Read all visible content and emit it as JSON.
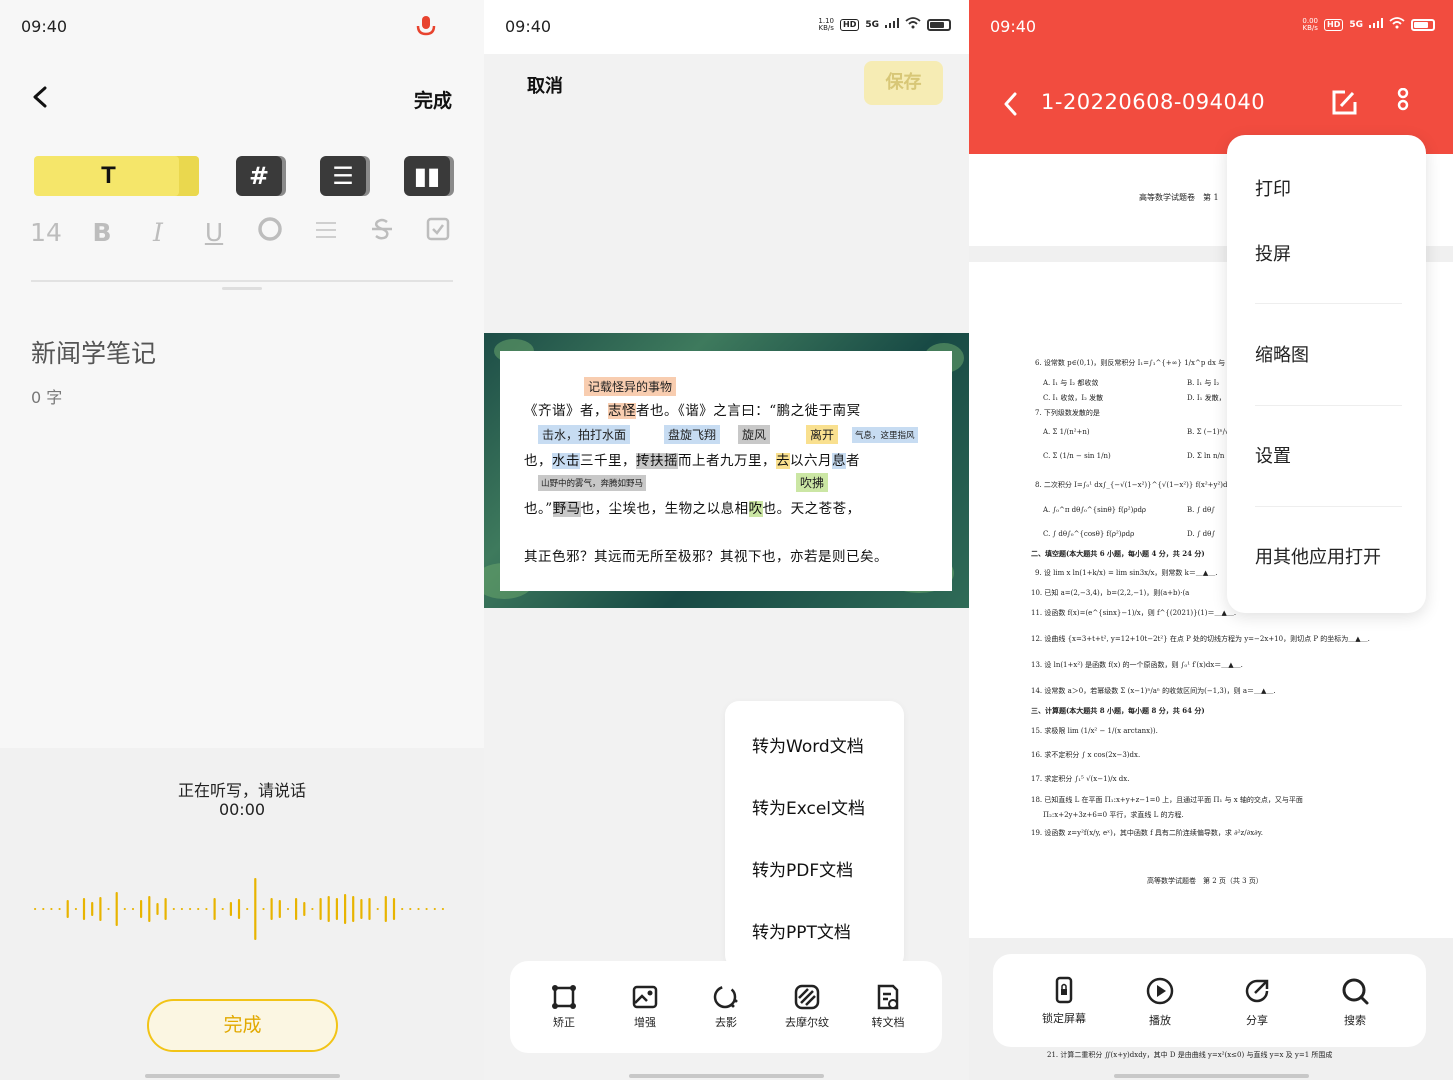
{
  "editor": {
    "time": "09:40",
    "done_top": "完成",
    "format_tools": [
      "T",
      "14",
      "B",
      "I",
      "U"
    ],
    "note_title": "新闻学笔记",
    "char_count": "0 字",
    "listening": "正在听写，请说话",
    "timer": "00:00",
    "done_button": "完成"
  },
  "scanner": {
    "time": "09:40",
    "net_speed": "1.10\nKB/s",
    "net_type": "5G",
    "cancel": "取消",
    "save": "保存",
    "doc_tags": {
      "t1": "记载怪异的事物",
      "t2": "击水，拍打水面",
      "t3": "盘旋飞翔",
      "t4": "旋风",
      "t5": "离开",
      "t6": "气息，这里指风",
      "t7": "山野中的雾气，奔腾如野马",
      "t8": "吹拂"
    },
    "doc_lines": {
      "l1a": "《齐谐》者，",
      "l1b": "志怪",
      "l1c": "者也。《谐》之言曰：“鹏之徙于南冥",
      "l2a": "也，",
      "l2b": "水击",
      "l2c": "三千里，",
      "l2d": "抟扶摇",
      "l2e": "而上者九万里，",
      "l2f": "去",
      "l2g": "以六月",
      "l2h": "息",
      "l2i": "者",
      "l3a": "也。”",
      "l3b": "野马",
      "l3c": "也，尘埃也，生物之以息相",
      "l3d": "吹",
      "l3e": "也。天之苍苍，",
      "l4": "其正色邪？其远而无所至极邪？其视下也，亦若是则已矣。"
    },
    "convert_menu": [
      "转为Word文档",
      "转为Excel文档",
      "转为PDF文档",
      "转为PPT文档"
    ],
    "tools": [
      "矫正",
      "增强",
      "去影",
      "去摩尔纹",
      "转文档"
    ]
  },
  "pdf_viewer": {
    "time": "09:40",
    "net_speed": "0.00\nKB/s",
    "net_type": "5G",
    "file_title": "1-20220608-094040",
    "page_header": "高等数学试题卷　第 1",
    "more_menu": [
      "打印",
      "投屏",
      "缩略图",
      "设置",
      "用其他应用打开"
    ],
    "exam_lines": {
      "q6": "6. 设常数 p∈(0,1)，则反常积分 I₁=∫₁^{+∞} 1/x^p dx 与 I₂=",
      "q6a": "A. I₁ 与 I₂ 都收敛",
      "q6b": "B. I₁ 与 I₂",
      "q6c": "C. I₁ 收敛，I₂ 发散",
      "q6d": "D. I₁ 发散，",
      "q7": "7. 下列级数发散的是",
      "q7a": "A. Σ 1/(n²+n)",
      "q7b": "B. Σ (−1)ⁿ/√n",
      "q7c": "C. Σ (1/n − sin 1/n)",
      "q7d": "D. Σ ln n/n",
      "q8": "8. 二次积分 I=∫₀¹ dx∫_{−√(1−x²)}^{√(1−x²)} f(x²+y²)dy 在极坐标系",
      "q8a": "A. ∫₀^π dθ∫₀^{sinθ} f(ρ²)ρdρ",
      "q8b": "B. ∫ dθ∫",
      "q8c": "C. ∫ dθ∫₀^{cosθ} f(ρ²)ρdρ",
      "q8d": "D. ∫ dθ∫",
      "sec2": "二、填空题(本大题共 6 小题，每小题 4 分，共 24 分)",
      "q9": "9. 设 lim x ln(1+k/x) = lim sin3x/x，则常数 k＝＿▲＿.",
      "q10": "10. 已知 a=(2,−3,4)，b=(2,2,−1)，则(a+b)·(a",
      "q11": "11. 设函数 f(x)=(e^{sinx}−1)/x，则 f^{(2021)}(1)＝＿▲＿.",
      "q12": "12. 设曲线 {x=3+t+t², y=12+10t−2t²} 在点 P 处的切线方程为 y=−2x+10，则切点 P 的坐标为＿▲＿.",
      "q13": "13. 设 ln(1+x²) 是函数 f(x) 的一个原函数，则 ∫₀¹ f′(x)dx＝＿▲＿.",
      "q14": "14. 设常数 a＞0，若幂级数 Σ (x−1)ⁿ/aⁿ 的收敛区间为(−1,3)，则 a＝＿▲＿.",
      "sec3": "三、计算题(本大题共 8 小题，每小题 8 分，共 64 分)",
      "q15": "15. 求极限 lim (1/x² − 1/(x arctanx)).",
      "q16": "16. 求不定积分 ∫ x cos(2x−3)dx.",
      "q17": "17. 求定积分 ∫₁⁵ √(x−1)/x dx.",
      "q18": "18. 已知直线 L 在平面 Π₁:x+y+z−1=0 上，且通过平面 Π₁ 与 x 轴的交点，又与平面",
      "q18b": "Π₂:x+2y+3z+6=0 平行，求直线 L 的方程.",
      "q19": "19. 设函数 z=y²f(x/y, eˣ)，其中函数 f 具有二阶连续偏导数，求 ∂²z/∂x∂y.",
      "footer": "高等数学试题卷　第 2 页（共 3 页）",
      "q21": "21. 计算二重积分 ∬(x+y)dxdy，其中 D 是由曲线 y=x²(x≤0) 与直线 y=x 及 y=1 所围成"
    },
    "tools": [
      "锁定屏幕",
      "播放",
      "分享",
      "搜索"
    ]
  },
  "colors": {
    "accent_yellow": "#f5e66a",
    "accent_red": "#f24c3f",
    "wave": "#e8b400"
  }
}
